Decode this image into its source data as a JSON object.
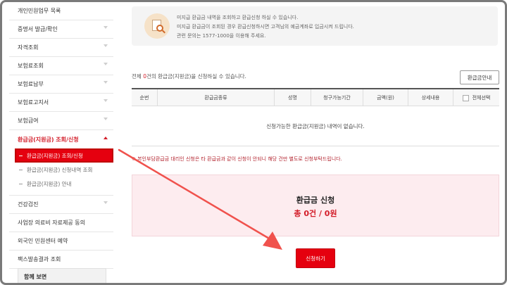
{
  "sidebar": {
    "items_top": [
      {
        "label": "개인민원업무 목록",
        "chevron": false
      },
      {
        "label": "증명서 발급/확인",
        "chevron": true
      },
      {
        "label": "자격조회",
        "chevron": true
      },
      {
        "label": "보험료조회",
        "chevron": true
      },
      {
        "label": "보험료납부",
        "chevron": true
      },
      {
        "label": "보험료고지서",
        "chevron": true
      },
      {
        "label": "보험급여",
        "chevron": true
      }
    ],
    "active_item": {
      "label": "환급금(지원금) 조회/신청"
    },
    "sub_items": [
      {
        "label": "환급금(지원금) 조회/신청",
        "current": true
      },
      {
        "label": "환급금(지원금) 신청내역 조회",
        "current": false
      },
      {
        "label": "환급금(지원금) 안내",
        "current": false
      }
    ],
    "items_bottom": [
      {
        "label": "건강검진",
        "chevron": true
      },
      {
        "label": "사업장 의료비 자료제공 동의",
        "chevron": false
      },
      {
        "label": "외국인 민원센터 예약",
        "chevron": false
      },
      {
        "label": "팩스발송결과 조회",
        "chevron": false
      }
    ],
    "see_also": "함께 보면"
  },
  "info": {
    "icon": "document-search-icon",
    "lines": [
      "미지급 환급금 내역을 조회하고 환급신청 하실 수 있습니다.",
      "미지급 환급금이 조회된 경우 환급신청하시면 고객님의 예금계좌로 입금시켜 드립니다.",
      "관련 문의는 1577-1000을 이용해 주세요."
    ]
  },
  "summary": {
    "prefix": "전체 ",
    "count": "0",
    "suffix": "건의 환급금(지원금)을 신청하실 수 있습니다."
  },
  "guide_button": "환급금안내",
  "table": {
    "headers": [
      "순번",
      "환급금종류",
      "성명",
      "청구가능기간",
      "금액(원)",
      "상세내용",
      "전체선택"
    ],
    "empty_message": "신청가능한 환급금(지원금) 내역이 없습니다."
  },
  "notice": "※ 본인부담환급금 대리인 신청은 타 환급금과 같이 신청이 안되니 해당 건만 별도로 신청부탁드립니다.",
  "refund_box": {
    "title": "환급금 신청",
    "total": "총 0건 / 0원"
  },
  "apply_button": "신청하기",
  "colors": {
    "accent": "#e5000f",
    "annotation_arrow": "#f0524d"
  }
}
